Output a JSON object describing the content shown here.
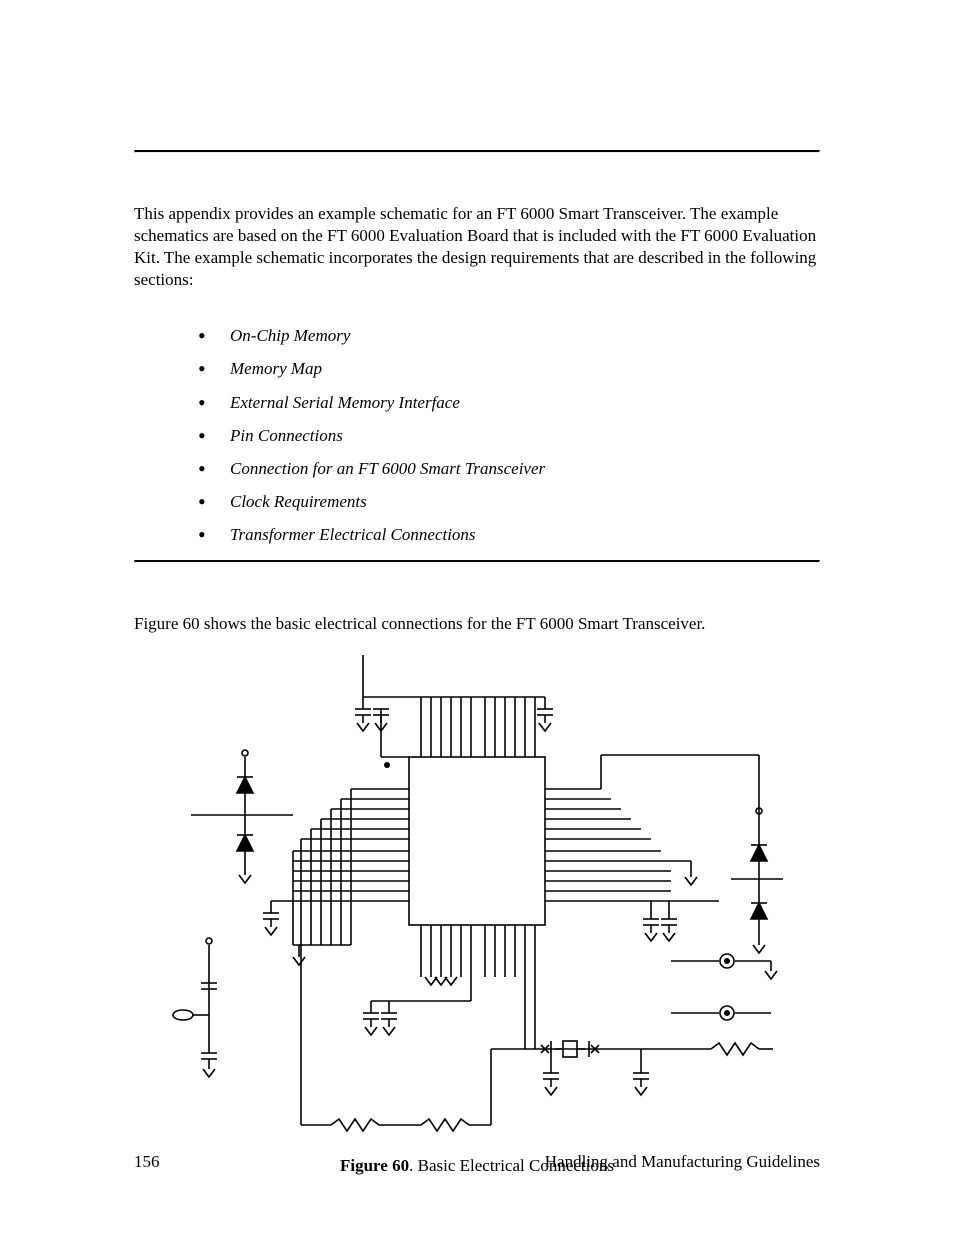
{
  "intro": "This appendix provides an example schematic for an FT 6000 Smart Transceiver.  The example schematics are based on the FT 6000 Evaluation Board that is included with the FT 6000 Evaluation Kit.  The example schematic incorporates the design requirements that are described in the following sections:",
  "bullets": [
    "On-Chip Memory",
    "Memory Map",
    "External Serial Memory Interface",
    "Pin Connections",
    "Connection for an FT 6000 Smart Transceiver",
    "Clock Requirements",
    "Transformer Electrical Connections"
  ],
  "caption_line": "Figure 60 shows the basic electrical connections for the FT 6000 Smart Transceiver.",
  "figure": {
    "label_bold": "Figure 60",
    "label_rest": ". Basic Electrical Connections"
  },
  "footer": {
    "page_number": "156",
    "section_title": "Handling and Manufacturing Guidelines"
  }
}
